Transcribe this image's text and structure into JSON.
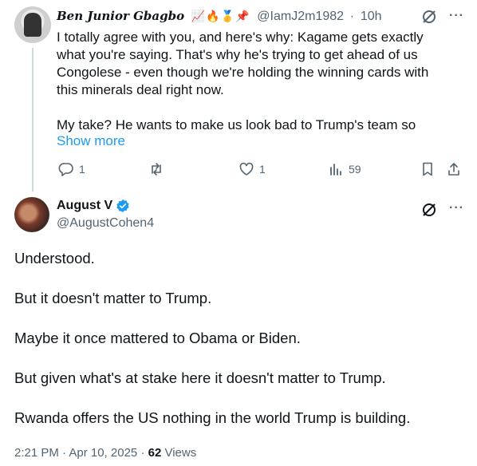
{
  "reply": {
    "author_name": "Ben Junior Gbagbo",
    "emojis": "📈🔥🥇📌",
    "handle": "@IamJ2m1982",
    "separator": "·",
    "time": "10h",
    "more": "···",
    "paragraph1": "I totally agree with you, and here's why: Kagame gets exactly what you're saying. That's why he's trying to get ahead of us Congolese - even though we're holding the winning cards with this minerals deal right now.",
    "paragraph2": "My take? He wants to make us look bad to Trump's team so",
    "show_more": "Show more",
    "replies": "1",
    "likes": "1",
    "views": "59"
  },
  "tweet": {
    "author_name": "August V",
    "handle": "@AugustCohen4",
    "more": "···",
    "paragraphs": [
      "Understood.",
      "But it doesn't matter to Trump.",
      "Maybe it once mattered to Obama or Biden.",
      "But given what's at stake here it doesn't matter to Trump.",
      "Rwanda offers the US nothing in the world Trump is building."
    ],
    "time": "2:21 PM · Apr 10, 2025",
    "separator": "·",
    "views_count": "62",
    "views_label": "Views"
  },
  "colors": {
    "accent": "#1d9bf0",
    "text": "#0f1419",
    "muted": "#536471",
    "thread_line": "#cfd9de"
  }
}
